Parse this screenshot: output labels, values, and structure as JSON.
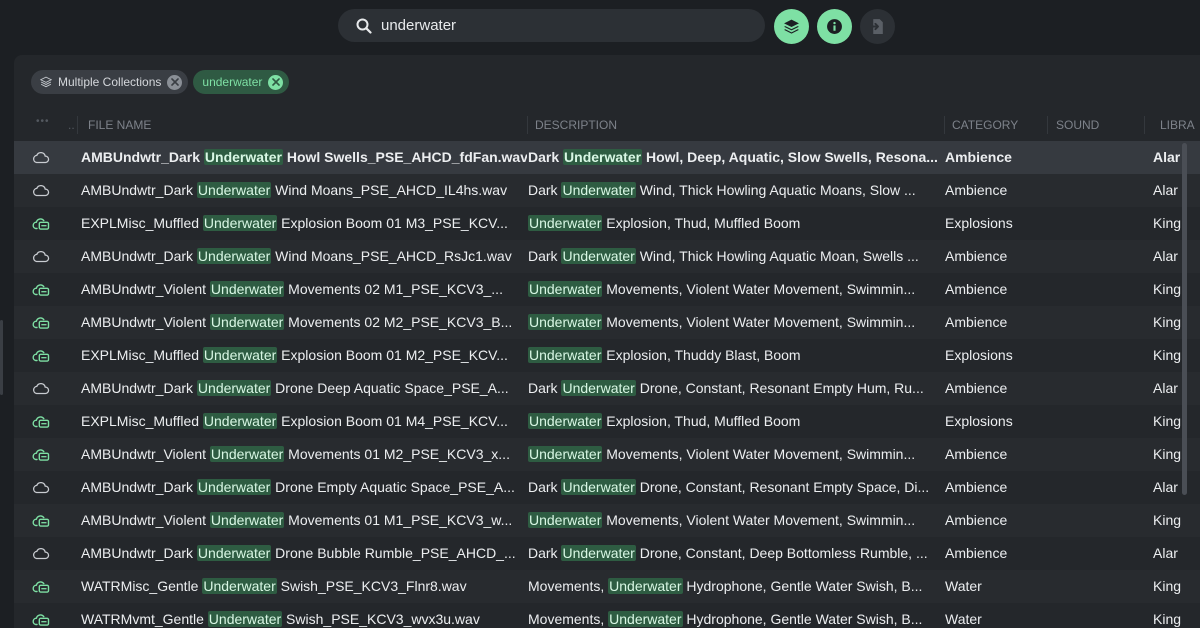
{
  "search": {
    "value": "underwater"
  },
  "toolbar": {
    "collections_icon": "layers-icon",
    "info_icon": "info-icon",
    "export_icon": "export-icon"
  },
  "filters": [
    {
      "label": "Multiple Collections",
      "icon": "layers-icon"
    },
    {
      "label": "underwater"
    }
  ],
  "table": {
    "headers": {
      "dots": "•••",
      "dd": "..",
      "file": "FILE NAME",
      "description": "DESCRIPTION",
      "category": "CATEGORY",
      "sound": "SOUND",
      "library": "LIBRA"
    },
    "highlight_term": "Underwater",
    "rows": [
      {
        "icon": "cloud-icon",
        "file": "AMBUndwtr_Dark Underwater Howl Swells_PSE_AHCD_fdFan.wav",
        "description": "Dark Underwater Howl, Deep, Aquatic, Slow Swells, Resona...",
        "category": "Ambience",
        "library": "Alar"
      },
      {
        "icon": "cloud-icon",
        "file": "AMBUndwtr_Dark Underwater Wind Moans_PSE_AHCD_IL4hs.wav",
        "description": "Dark Underwater Wind, Thick Howling Aquatic Moans, Slow ...",
        "category": "Ambience",
        "library": "Alar"
      },
      {
        "icon": "cloud-local-icon",
        "file": "EXPLMisc_Muffled Underwater Explosion Boom 01 M3_PSE_KCV...",
        "description": "Underwater Explosion, Thud, Muffled Boom",
        "category": "Explosions",
        "library": "King"
      },
      {
        "icon": "cloud-icon",
        "file": "AMBUndwtr_Dark Underwater Wind Moans_PSE_AHCD_RsJc1.wav",
        "description": "Dark Underwater Wind, Thick Howling Aquatic Moan, Swells ...",
        "category": "Ambience",
        "library": "Alar"
      },
      {
        "icon": "cloud-local-icon",
        "file": "AMBUndwtr_Violent Underwater Movements 02 M1_PSE_KCV3_...",
        "description": "Underwater Movements, Violent Water Movement, Swimmin...",
        "category": "Ambience",
        "library": "King"
      },
      {
        "icon": "cloud-local-icon",
        "file": "AMBUndwtr_Violent Underwater Movements 02 M2_PSE_KCV3_B...",
        "description": "Underwater Movements, Violent Water Movement, Swimmin...",
        "category": "Ambience",
        "library": "King"
      },
      {
        "icon": "cloud-local-icon",
        "file": "EXPLMisc_Muffled Underwater Explosion Boom 01 M2_PSE_KCV...",
        "description": "Underwater Explosion, Thuddy Blast, Boom",
        "category": "Explosions",
        "library": "King"
      },
      {
        "icon": "cloud-icon",
        "file": "AMBUndwtr_Dark Underwater Drone Deep Aquatic Space_PSE_A...",
        "description": "Dark Underwater Drone, Constant, Resonant Empty Hum, Ru...",
        "category": "Ambience",
        "library": "Alar"
      },
      {
        "icon": "cloud-local-icon",
        "file": "EXPLMisc_Muffled Underwater Explosion Boom 01 M4_PSE_KCV...",
        "description": "Underwater Explosion, Thud, Muffled Boom",
        "category": "Explosions",
        "library": "King"
      },
      {
        "icon": "cloud-local-icon",
        "file": "AMBUndwtr_Violent Underwater Movements 01 M2_PSE_KCV3_x...",
        "description": "Underwater Movements, Violent Water Movement, Swimmin...",
        "category": "Ambience",
        "library": "King"
      },
      {
        "icon": "cloud-icon",
        "file": "AMBUndwtr_Dark Underwater Drone Empty Aquatic Space_PSE_A...",
        "description": "Dark Underwater Drone, Constant, Resonant Empty Space, Di...",
        "category": "Ambience",
        "library": "Alar"
      },
      {
        "icon": "cloud-local-icon",
        "file": "AMBUndwtr_Violent Underwater Movements 01 M1_PSE_KCV3_w...",
        "description": "Underwater Movements, Violent Water Movement, Swimmin...",
        "category": "Ambience",
        "library": "King"
      },
      {
        "icon": "cloud-icon",
        "file": "AMBUndwtr_Dark Underwater Drone Bubble Rumble_PSE_AHCD_...",
        "description": "Dark Underwater Drone, Constant, Deep Bottomless Rumble, ...",
        "category": "Ambience",
        "library": "Alar"
      },
      {
        "icon": "cloud-local-icon",
        "file": "WATRMisc_Gentle Underwater Swish_PSE_KCV3_Flnr8.wav",
        "description": "Movements, Underwater Hydrophone, Gentle Water Swish, B...",
        "category": "Water",
        "library": "King"
      },
      {
        "icon": "cloud-local-icon",
        "file": "WATRMvmt_Gentle Underwater Swish_PSE_KCV3_wvx3u.wav",
        "description": "Movements, Underwater Hydrophone, Gentle Water Swish, B...",
        "category": "Water",
        "library": "King"
      }
    ]
  }
}
